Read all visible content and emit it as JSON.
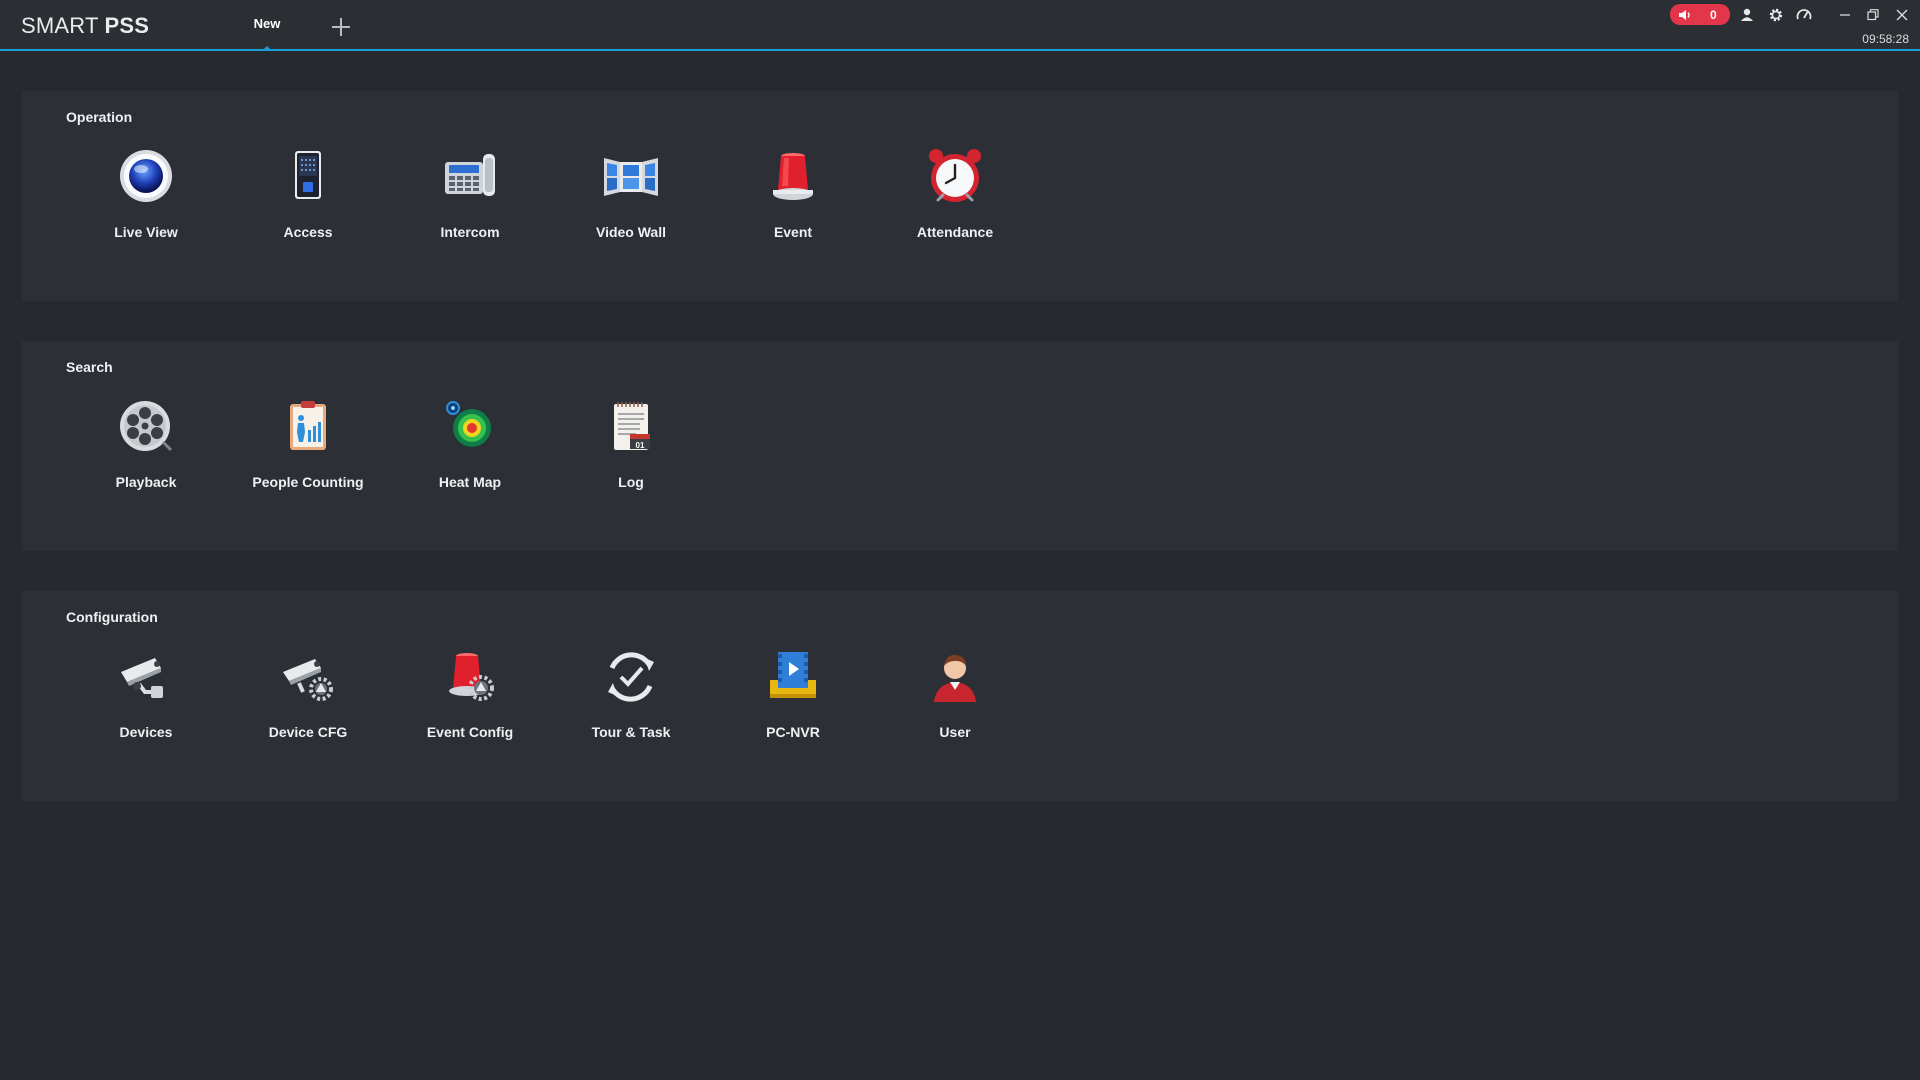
{
  "app": {
    "brand_light": "SMART",
    "brand_bold": "PSS",
    "accent": "#1aa0d8"
  },
  "tabs": [
    {
      "label": "New",
      "active": true
    }
  ],
  "statusbar": {
    "alarm_count": "0",
    "time": "09:58:28"
  },
  "sections": {
    "operation": {
      "title": "Operation",
      "items": [
        {
          "label": "Live View",
          "icon": "live-view-icon"
        },
        {
          "label": "Access",
          "icon": "access-icon"
        },
        {
          "label": "Intercom",
          "icon": "intercom-icon"
        },
        {
          "label": "Video Wall",
          "icon": "video-wall-icon"
        },
        {
          "label": "Event",
          "icon": "event-icon"
        },
        {
          "label": "Attendance",
          "icon": "attendance-icon"
        }
      ]
    },
    "search": {
      "title": "Search",
      "items": [
        {
          "label": "Playback",
          "icon": "playback-icon"
        },
        {
          "label": "People Counting",
          "icon": "people-counting-icon"
        },
        {
          "label": "Heat Map",
          "icon": "heat-map-icon"
        },
        {
          "label": "Log",
          "icon": "log-icon"
        }
      ]
    },
    "configuration": {
      "title": "Configuration",
      "items": [
        {
          "label": "Devices",
          "icon": "devices-icon"
        },
        {
          "label": "Device CFG",
          "icon": "device-cfg-icon"
        },
        {
          "label": "Event Config",
          "icon": "event-config-icon"
        },
        {
          "label": "Tour & Task",
          "icon": "tour-task-icon"
        },
        {
          "label": "PC-NVR",
          "icon": "pc-nvr-icon"
        },
        {
          "label": "User",
          "icon": "user-icon"
        }
      ]
    }
  }
}
